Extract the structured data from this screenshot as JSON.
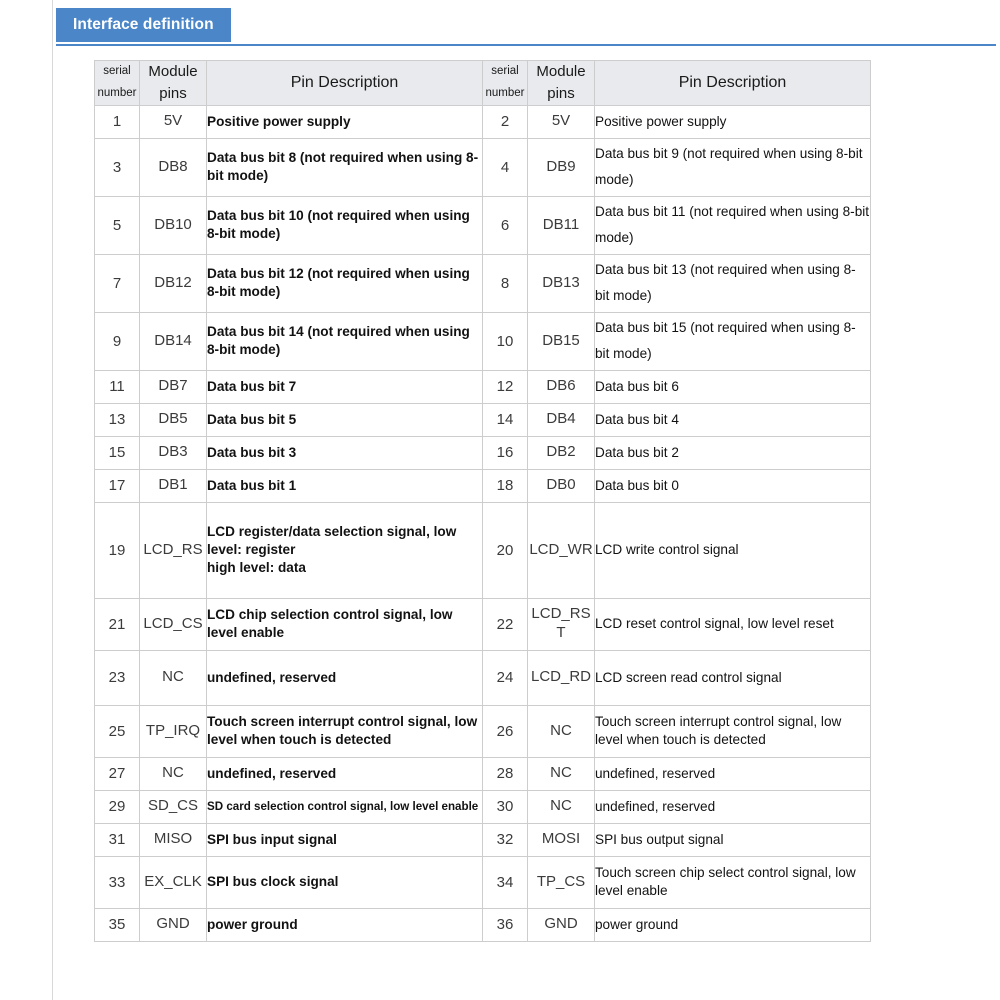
{
  "tab": {
    "label": "Interface definition"
  },
  "accent_color": "#4a86c8",
  "table": {
    "headers": {
      "serial_number_line1": "serial",
      "serial_number_line2": "number",
      "module_pins_line1": "Module",
      "module_pins_line2": "pins",
      "pin_description": "Pin Description"
    },
    "rows": [
      {
        "left": {
          "num": "1",
          "pin": "5V",
          "desc": "Positive power supply"
        },
        "right": {
          "num": "2",
          "pin": "5V",
          "desc": "Positive power supply"
        }
      },
      {
        "left": {
          "num": "3",
          "pin": "DB8",
          "desc": "Data bus bit 8 (not required when using 8-bit mode)"
        },
        "right": {
          "num": "4",
          "pin": "DB9",
          "desc": "Data bus bit 9 (not required when using 8-bit mode)"
        }
      },
      {
        "left": {
          "num": "5",
          "pin": "DB10",
          "desc": "Data bus bit 10 (not required when using 8-bit mode)"
        },
        "right": {
          "num": "6",
          "pin": "DB11",
          "desc": "Data bus bit 11 (not required when using 8-bit mode)"
        }
      },
      {
        "left": {
          "num": "7",
          "pin": "DB12",
          "desc": "Data bus bit 12 (not required when using 8-bit mode)"
        },
        "right": {
          "num": "8",
          "pin": "DB13",
          "desc": "Data bus bit 13 (not required when using 8-bit mode)"
        }
      },
      {
        "left": {
          "num": "9",
          "pin": "DB14",
          "desc": "Data bus bit 14 (not required when using 8-bit mode)"
        },
        "right": {
          "num": "10",
          "pin": "DB15",
          "desc": "Data bus bit 15 (not required when using 8-bit mode)"
        }
      },
      {
        "left": {
          "num": "11",
          "pin": "DB7",
          "desc": "Data bus bit 7"
        },
        "right": {
          "num": "12",
          "pin": "DB6",
          "desc": "Data bus bit 6"
        }
      },
      {
        "left": {
          "num": "13",
          "pin": "DB5",
          "desc": "Data bus bit 5"
        },
        "right": {
          "num": "14",
          "pin": "DB4",
          "desc": "Data bus bit 4"
        }
      },
      {
        "left": {
          "num": "15",
          "pin": "DB3",
          "desc": "Data bus bit 3"
        },
        "right": {
          "num": "16",
          "pin": "DB2",
          "desc": "Data bus bit 2"
        }
      },
      {
        "left": {
          "num": "17",
          "pin": "DB1",
          "desc": "Data bus bit 1"
        },
        "right": {
          "num": "18",
          "pin": "DB0",
          "desc": "Data bus bit 0"
        }
      },
      {
        "left": {
          "num": "19",
          "pin": "LCD_RS",
          "desc": "LCD register/data selection signal, low level: register\nhigh level: data"
        },
        "right": {
          "num": "20",
          "pin": "LCD_WR",
          "desc": "LCD write control signal"
        }
      },
      {
        "left": {
          "num": "21",
          "pin": "LCD_CS",
          "desc": "LCD chip selection control signal, low level enable"
        },
        "right": {
          "num": "22",
          "pin": "LCD_RST",
          "desc": "LCD reset control signal, low level reset"
        }
      },
      {
        "left": {
          "num": "23",
          "pin": "NC",
          "desc": "undefined, reserved"
        },
        "right": {
          "num": "24",
          "pin": "LCD_RD",
          "desc": "LCD screen read control signal"
        }
      },
      {
        "left": {
          "num": "25",
          "pin": "TP_IRQ",
          "desc": "Touch screen interrupt control signal, low level when touch is detected"
        },
        "right": {
          "num": "26",
          "pin": "NC",
          "desc": "Touch screen interrupt control signal, low level when touch is detected"
        }
      },
      {
        "left": {
          "num": "27",
          "pin": "NC",
          "desc": "undefined, reserved"
        },
        "right": {
          "num": "28",
          "pin": "NC",
          "desc": "undefined, reserved"
        }
      },
      {
        "left": {
          "num": "29",
          "pin": "SD_CS",
          "desc": "SD card selection control signal, low level enable"
        },
        "right": {
          "num": "30",
          "pin": "NC",
          "desc": "undefined, reserved"
        }
      },
      {
        "left": {
          "num": "31",
          "pin": "MISO",
          "desc": "SPI bus input signal"
        },
        "right": {
          "num": "32",
          "pin": "MOSI",
          "desc": "SPI bus output signal"
        }
      },
      {
        "left": {
          "num": "33",
          "pin": "EX_CLK",
          "desc": "SPI bus clock signal"
        },
        "right": {
          "num": "34",
          "pin": "TP_CS",
          "desc": "Touch screen chip select control signal, low level enable"
        }
      },
      {
        "left": {
          "num": "35",
          "pin": "GND",
          "desc": "power ground"
        },
        "right": {
          "num": "36",
          "pin": "GND",
          "desc": "power ground"
        }
      }
    ]
  }
}
